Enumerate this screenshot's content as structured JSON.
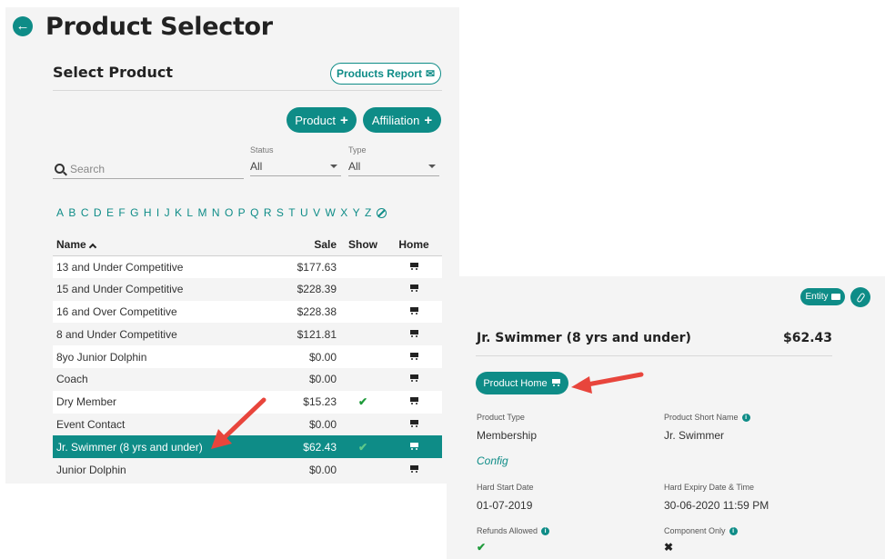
{
  "header": {
    "title": "Product Selector",
    "section_title": "Select Product"
  },
  "toolbar": {
    "report_label": "Products Report",
    "product_label": "Product",
    "affiliation_label": "Affiliation"
  },
  "filters": {
    "search_placeholder": "Search",
    "status_label": "Status",
    "status_value": "All",
    "type_label": "Type",
    "type_value": "All"
  },
  "alphabet": [
    "A",
    "B",
    "C",
    "D",
    "E",
    "F",
    "G",
    "H",
    "I",
    "J",
    "K",
    "L",
    "M",
    "N",
    "O",
    "P",
    "Q",
    "R",
    "S",
    "T",
    "U",
    "V",
    "W",
    "X",
    "Y",
    "Z"
  ],
  "table": {
    "headers": {
      "name": "Name",
      "sale": "Sale",
      "show": "Show",
      "home": "Home"
    },
    "rows": [
      {
        "name": "13 and Under Competitive",
        "sale": "$177.63",
        "show": false
      },
      {
        "name": "15 and Under Competitive",
        "sale": "$228.39",
        "show": false
      },
      {
        "name": "16 and Over Competitive",
        "sale": "$228.38",
        "show": false
      },
      {
        "name": "8 and Under Competitive",
        "sale": "$121.81",
        "show": false
      },
      {
        "name": "8yo Junior Dolphin",
        "sale": "$0.00",
        "show": false
      },
      {
        "name": "Coach",
        "sale": "$0.00",
        "show": false
      },
      {
        "name": "Dry Member",
        "sale": "$15.23",
        "show": true
      },
      {
        "name": "Event Contact",
        "sale": "$0.00",
        "show": false
      },
      {
        "name": "Jr. Swimmer (8 yrs and under)",
        "sale": "$62.43",
        "show": true,
        "selected": true
      },
      {
        "name": "Junior Dolphin",
        "sale": "$0.00",
        "show": false
      }
    ]
  },
  "detail": {
    "entity_label": "Entity",
    "title": "Jr. Swimmer (8 yrs and under)",
    "price": "$62.43",
    "home_label": "Product Home",
    "product_type_label": "Product Type",
    "product_type_value": "Membership",
    "short_name_label": "Product Short Name",
    "short_name_value": "Jr. Swimmer",
    "config_label": "Config",
    "hard_start_label": "Hard Start Date",
    "hard_start_value": "01-07-2019",
    "hard_expiry_label": "Hard Expiry Date & Time",
    "hard_expiry_value": "30-06-2020 11:59 PM",
    "refunds_label": "Refunds Allowed",
    "refunds_value": true,
    "component_label": "Component Only",
    "component_value": false
  },
  "colors": {
    "accent": "#0e8c87",
    "arrow": "#e8453c",
    "check": "#1e9a3a"
  }
}
